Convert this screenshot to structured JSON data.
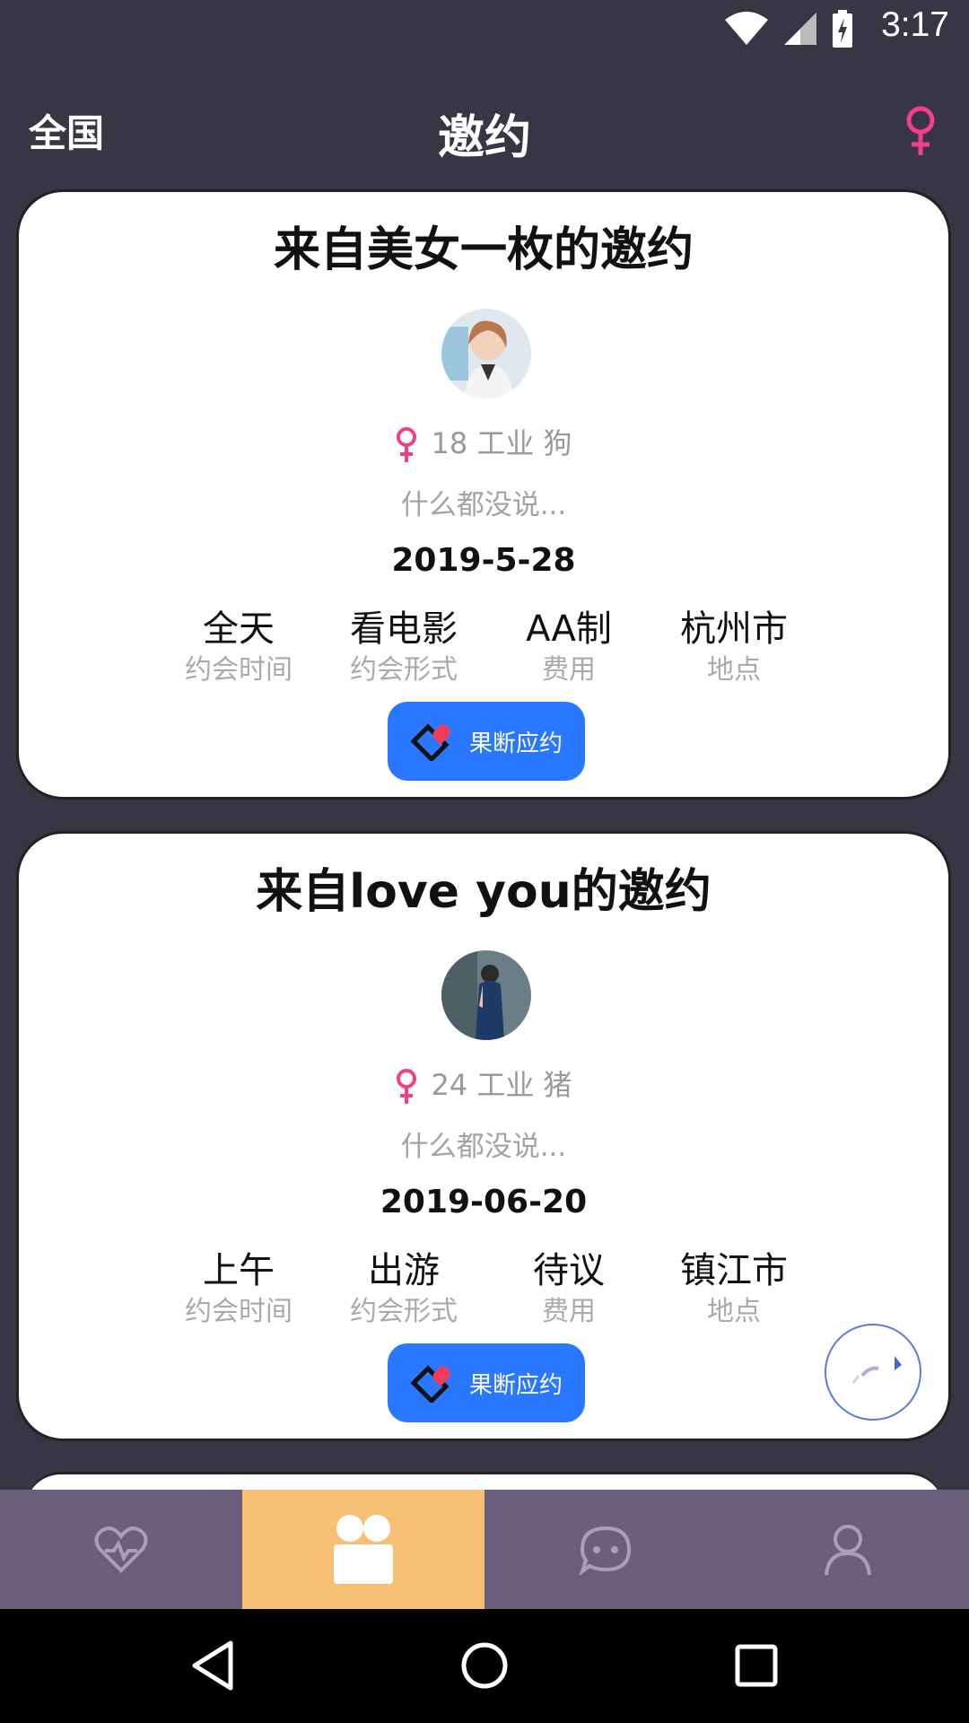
{
  "status_bar": {
    "time": "3:17",
    "icons": [
      "wifi-icon",
      "signal-icon",
      "battery-charging-icon"
    ]
  },
  "header": {
    "region": "全国",
    "title": "邀约",
    "filter_icon": "female-symbol-icon"
  },
  "cards": [
    {
      "title": "来自美女一枚的邀约",
      "meta": "18 工业 狗",
      "note": "什么都没说...",
      "date": "2019-5-28",
      "info": [
        {
          "value": "全天",
          "label": "约会时间"
        },
        {
          "value": "看电影",
          "label": "约会形式"
        },
        {
          "value": "AA制",
          "label": "费用"
        },
        {
          "value": "杭州市",
          "label": "地点"
        }
      ],
      "button": "果断应约"
    },
    {
      "title": "来自love you的邀约",
      "meta": "24 工业 猪",
      "note": "什么都没说...",
      "date": "2019-06-20",
      "info": [
        {
          "value": "上午",
          "label": "约会时间"
        },
        {
          "value": "出游",
          "label": "约会形式"
        },
        {
          "value": "待议",
          "label": "费用"
        },
        {
          "value": "镇江市",
          "label": "地点"
        }
      ],
      "button": "果断应约"
    }
  ],
  "tabbar": {
    "tabs": [
      {
        "icon": "heart-pulse-icon",
        "active": false
      },
      {
        "icon": "couple-icon",
        "active": true
      },
      {
        "icon": "chat-bubble-icon",
        "active": false
      },
      {
        "icon": "person-icon",
        "active": false
      }
    ],
    "active_color": "#f6c074",
    "bar_color": "#6b5f80"
  },
  "colors": {
    "accent": "#2a78ff",
    "female": "#f0408a",
    "background": "#383545"
  }
}
